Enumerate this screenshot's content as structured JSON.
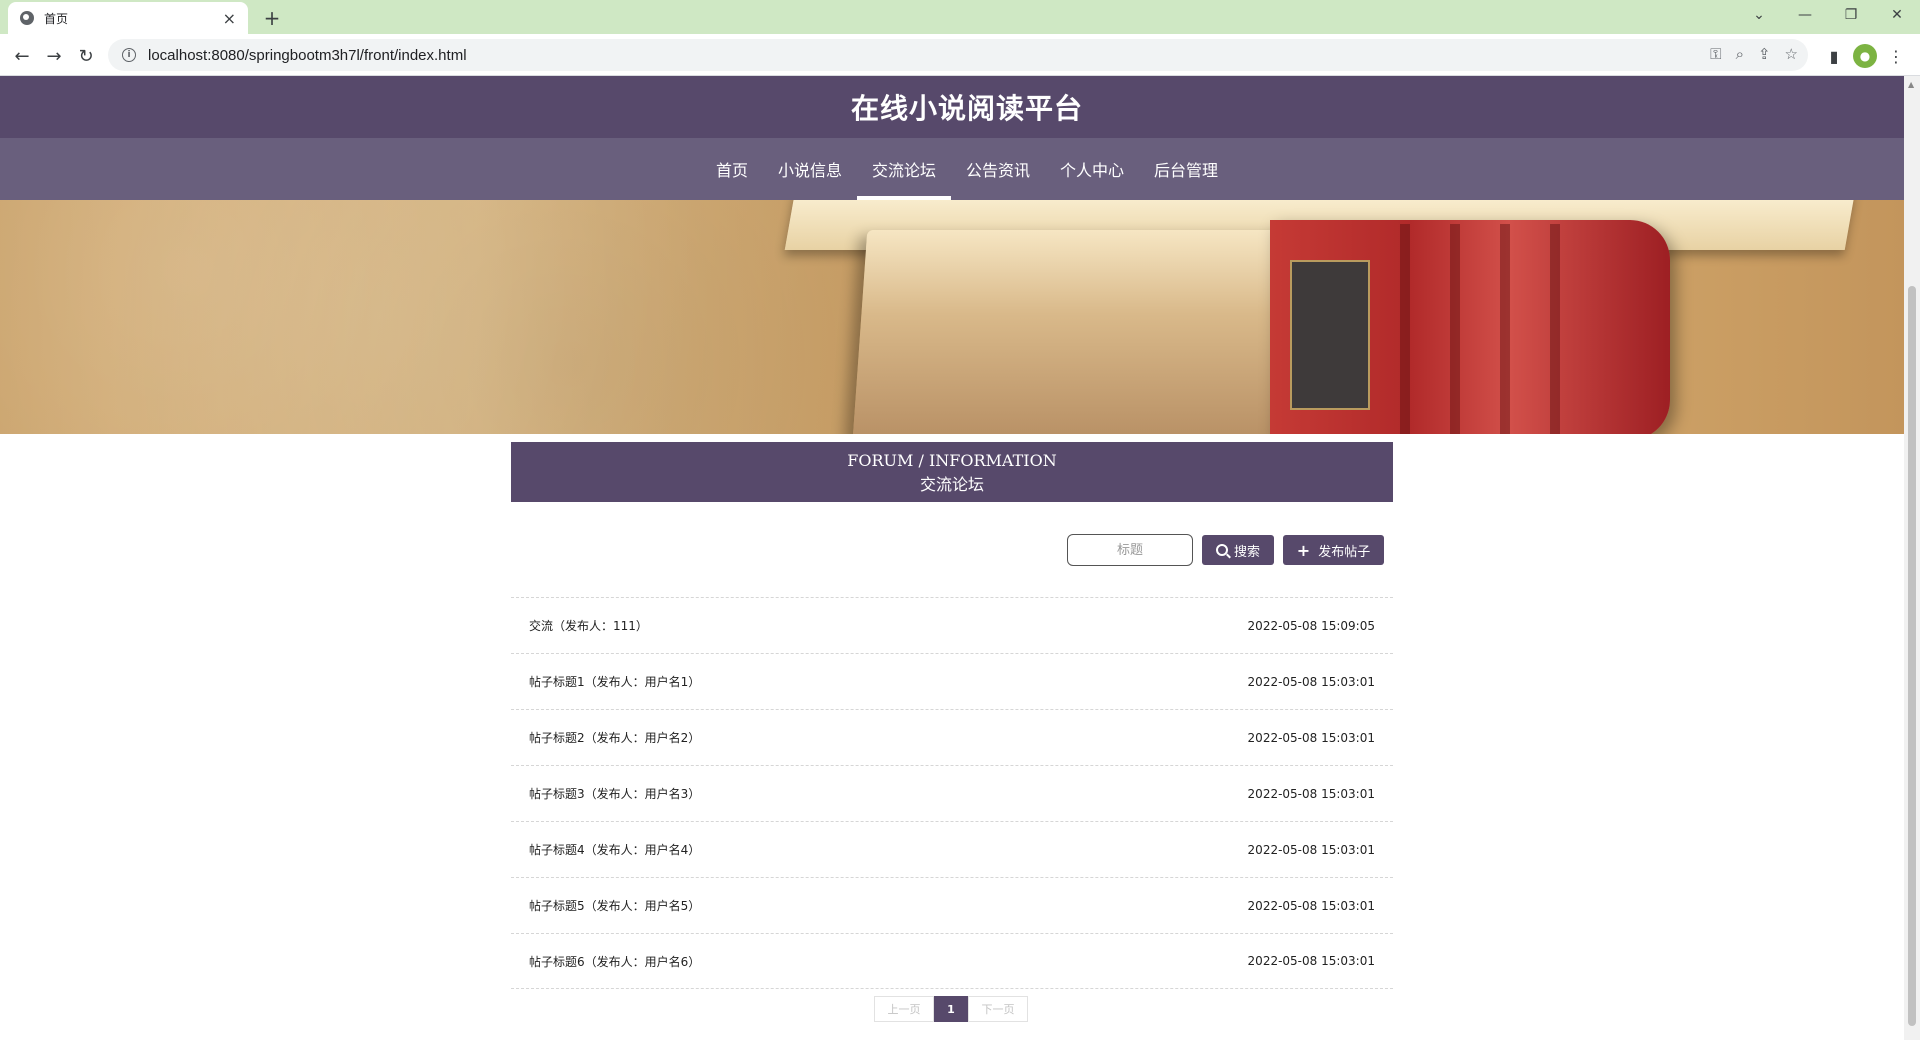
{
  "browser": {
    "tab_title": "首页",
    "tab_close": "×",
    "new_tab": "+",
    "url": "localhost:8080/springbootm3h7l/front/index.html",
    "window": {
      "dropdown": "⌄",
      "minimize": "—",
      "restore": "❐",
      "close": "✕"
    },
    "nav": {
      "back": "←",
      "forward": "→",
      "reload": "↻"
    },
    "omnibox_icons": [
      "key-icon",
      "zoom-icon",
      "share-icon",
      "star-icon"
    ],
    "toolbar_icons": [
      "sidebar-icon",
      "profile-icon",
      "menu-icon"
    ]
  },
  "site": {
    "title": "在线小说阅读平台",
    "nav": [
      {
        "label": "首页",
        "active": false
      },
      {
        "label": "小说信息",
        "active": false
      },
      {
        "label": "交流论坛",
        "active": true
      },
      {
        "label": "公告资讯",
        "active": false
      },
      {
        "label": "个人中心",
        "active": false
      },
      {
        "label": "后台管理",
        "active": false
      }
    ],
    "banner": {
      "slide_count": 3,
      "active_slide": 1
    }
  },
  "forum": {
    "heading_en": "FORUM / INFORMATION",
    "heading_cn": "交流论坛",
    "search_placeholder": "标题",
    "search_label": "搜索",
    "post_label": "发布帖子",
    "posts": [
      {
        "title": "交流（发布人：111）",
        "time": "2022-05-08 15:09:05"
      },
      {
        "title": "帖子标题1（发布人：用户名1）",
        "time": "2022-05-08 15:03:01"
      },
      {
        "title": "帖子标题2（发布人：用户名2）",
        "time": "2022-05-08 15:03:01"
      },
      {
        "title": "帖子标题3（发布人：用户名3）",
        "time": "2022-05-08 15:03:01"
      },
      {
        "title": "帖子标题4（发布人：用户名4）",
        "time": "2022-05-08 15:03:01"
      },
      {
        "title": "帖子标题5（发布人：用户名5）",
        "time": "2022-05-08 15:03:01"
      },
      {
        "title": "帖子标题6（发布人：用户名6）",
        "time": "2022-05-08 15:03:01"
      }
    ],
    "pagination": {
      "prev": "上一页",
      "current": "1",
      "next": "下一页"
    }
  },
  "colors": {
    "header": "#57496b",
    "nav": "#695f7d",
    "tabstrip": "#cfe8c4"
  }
}
